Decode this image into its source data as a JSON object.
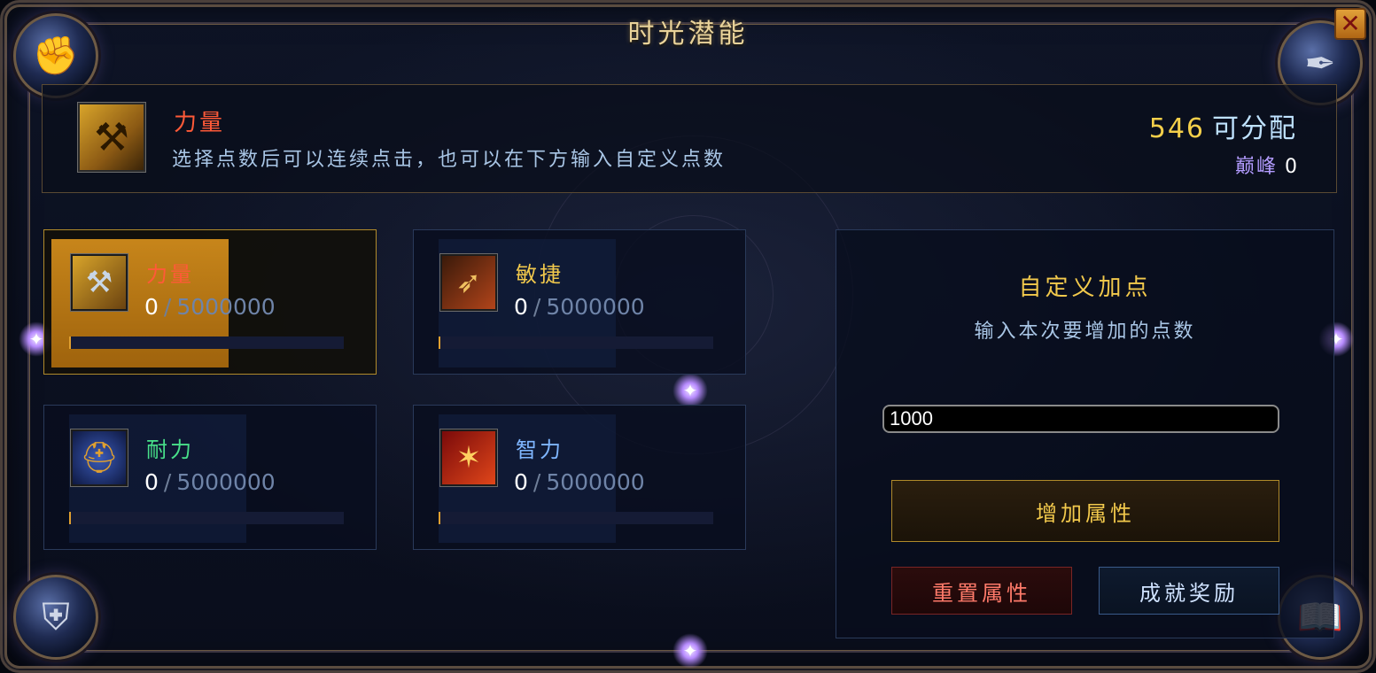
{
  "window": {
    "title": "时光潜能",
    "close_label": "✕"
  },
  "corners": {
    "top_left_icon": "gauntlet-icon",
    "top_right_icon": "quill-icon",
    "bottom_left_icon": "shield-icon",
    "bottom_right_icon": "book-icon"
  },
  "header": {
    "stat_name": "力量",
    "hint": "选择点数后可以连续点击，也可以在下方输入自定义点数",
    "points_value": "546",
    "points_label": "可分配",
    "peak_label": "巅峰",
    "peak_value": "0"
  },
  "stats": [
    {
      "name": "力量",
      "icon": "hammer-icon",
      "current": "0",
      "separator": "/",
      "max": "5000000",
      "name_color": "#ff5a38",
      "progress": 0,
      "selected": true
    },
    {
      "name": "敏捷",
      "icon": "bow-icon",
      "current": "0",
      "separator": "/",
      "max": "5000000",
      "name_color": "#f2c94c",
      "progress": 0,
      "selected": false
    },
    {
      "name": "耐力",
      "icon": "helmet-icon",
      "current": "0",
      "separator": "/",
      "max": "5000000",
      "name_color": "#48e08a",
      "progress": 0,
      "selected": false
    },
    {
      "name": "智力",
      "icon": "staff-icon",
      "current": "0",
      "separator": "/",
      "max": "5000000",
      "name_color": "#7fb6ff",
      "progress": 0,
      "selected": false
    }
  ],
  "custom": {
    "title": "自定义加点",
    "subtitle": "输入本次要增加的点数",
    "input_value": "1000",
    "add_button": "增加属性",
    "reset_button": "重置属性",
    "reward_button": "成就奖励"
  }
}
